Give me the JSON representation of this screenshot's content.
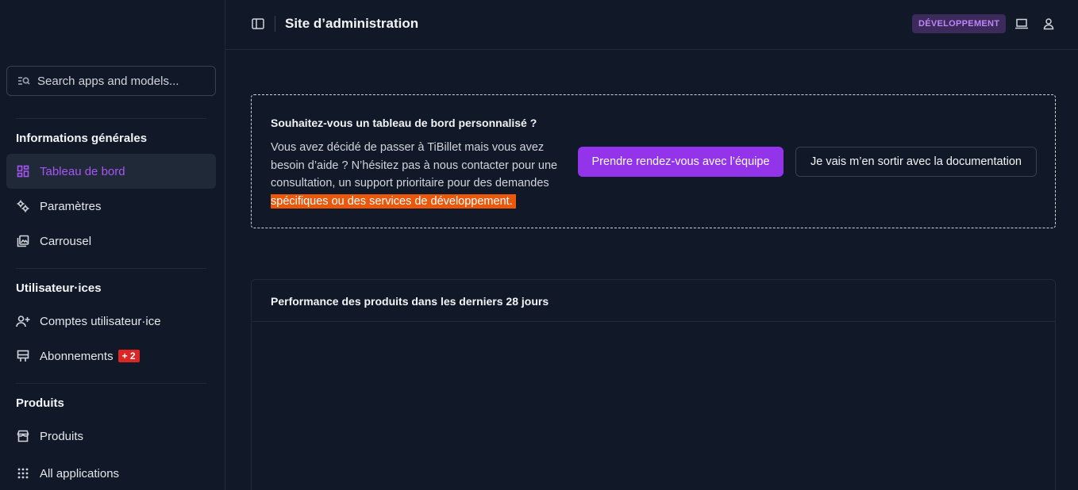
{
  "header": {
    "title": "Site d’administration",
    "env_badge": "DÉVELOPPEMENT"
  },
  "search": {
    "placeholder": "Search apps and models..."
  },
  "sidebar": {
    "groups": [
      {
        "title": "Informations générales",
        "items": [
          {
            "label": "Tableau de bord",
            "icon": "dashboard-icon",
            "active": true
          },
          {
            "label": "Paramètres",
            "icon": "settings-icon"
          },
          {
            "label": "Carrousel",
            "icon": "gallery-icon"
          }
        ]
      },
      {
        "title": "Utilisateur·ices",
        "items": [
          {
            "label": "Comptes utilisateur·ice",
            "icon": "person-add-icon"
          },
          {
            "label": "Abonnements",
            "icon": "subscriptions-icon",
            "badge": "+ 2"
          }
        ]
      },
      {
        "title": "Produits",
        "items": [
          {
            "label": "Produits",
            "icon": "store-icon"
          }
        ]
      }
    ],
    "all_apps": "All applications"
  },
  "promo": {
    "title": "Souhaitez-vous un tableau de bord personnalisé ?",
    "text": "Vous avez décidé de passer à TiBillet mais vous avez besoin d’aide ? N’hésitez pas à nous contacter pour une consultation, un support prioritaire pour des demandes",
    "highlight": "spécifiques ou des services de développement.",
    "primary_button": "Prendre rendez-vous avec l’équipe",
    "secondary_button": "Je vais m’en sortir avec la documentation"
  },
  "card": {
    "title": "Performance des produits dans les derniers 28 jours"
  },
  "colors": {
    "accent": "#9333ea",
    "highlight": "#ea580c",
    "badge": "#dc2626"
  }
}
